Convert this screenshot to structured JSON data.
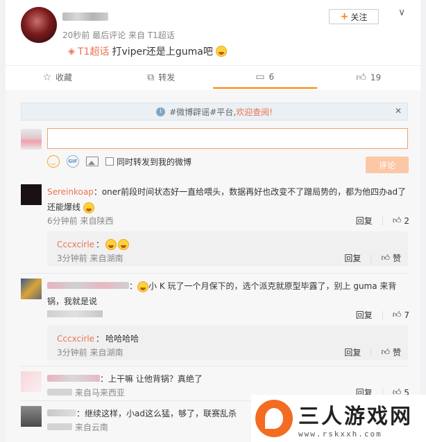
{
  "post": {
    "meta_time": "20秒前",
    "meta_last": "最后评论",
    "meta_from": "来自 T1超话",
    "topic": "T1超话",
    "text": "打viper还是上guma吧",
    "follow_label": "关注"
  },
  "actions": {
    "collect": "收藏",
    "repost": "转发",
    "comment_count": "6",
    "like_count": "19"
  },
  "notice": {
    "prefix": "#微博辟谣#平台,",
    "highlight": "欢迎查阅!"
  },
  "reply": {
    "also_repost": "同时转发到我的微博",
    "submit": "评论"
  },
  "comments": [
    {
      "name": "Sereinkoap",
      "text": "oner前段时间状态好一直给喂头，数据再好也改变不了蹭局势的，都为他四办ad了还能爆线",
      "meta": "6分钟前 来自陕西",
      "reply_label": "回复",
      "likes": "2",
      "sub": {
        "name": "Cccxcirle",
        "text": "",
        "meta": "3分钟前 来自湖南",
        "reply_label": "回复",
        "likes": "赞"
      }
    },
    {
      "name": "",
      "text": "小 K 玩了一个月保下的，选个派克就原型毕露了，别上 guma 来背锅，我就是说",
      "meta": "",
      "reply_label": "回复",
      "likes": "7",
      "sub": {
        "name": "Cccxcirle",
        "text": "哈哈哈哈",
        "meta": "3分钟前 来自湖南",
        "reply_label": "回复",
        "likes": "赞"
      }
    },
    {
      "name": "",
      "text": "上干嘛 让他背锅？真绝了",
      "meta": "来自马来西亚",
      "reply_label": "回复",
      "likes": "5"
    },
    {
      "name": "",
      "text": "继续这样，小ad这么猛，够了，联赛乱杀",
      "meta": "来自云南",
      "reply_label": "",
      "likes": ""
    }
  ],
  "watermark": {
    "title": "三人游戏网",
    "url": "www.rskxxh.com"
  }
}
